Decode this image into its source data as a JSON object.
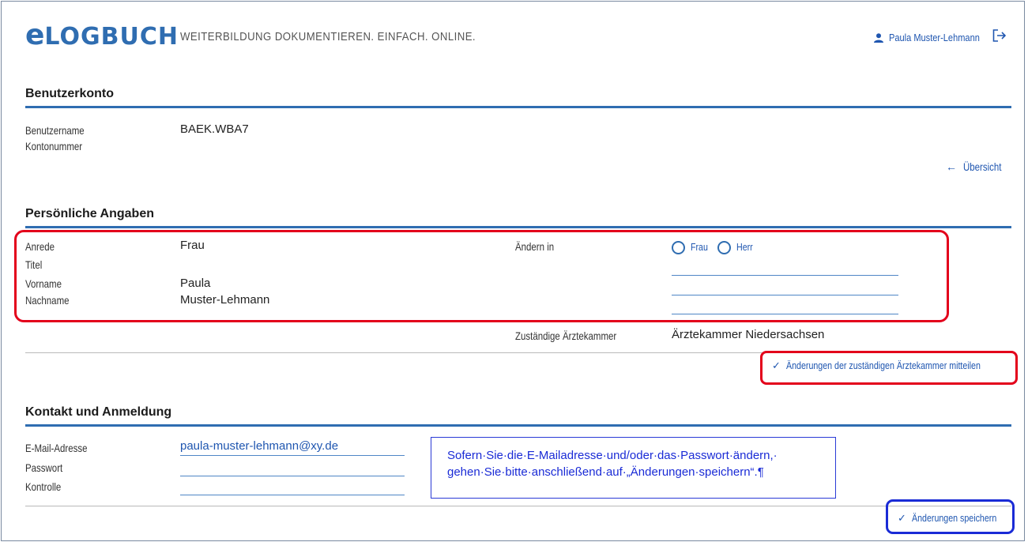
{
  "header": {
    "logo": "eLOGBUCH",
    "logo_e": "e",
    "logo_rest": "LOGBUCH",
    "tagline": "WEITERBILDUNG DOKUMENTIEREN. EINFACH. ONLINE.",
    "user_name": "Paula Muster-Lehmann"
  },
  "account": {
    "title": "Benutzerkonto",
    "username_label": "Benutzername",
    "username_value": "BAEK.WBA7",
    "account_number_label": "Kontonummer",
    "overview_link": "Übersicht"
  },
  "personal": {
    "title": "Persönliche Angaben",
    "salutation_label": "Anrede",
    "salutation_value": "Frau",
    "title_label": "Titel",
    "firstname_label": "Vorname",
    "firstname_value": "Paula",
    "lastname_label": "Nachname",
    "lastname_value": "Muster-Lehmann",
    "change_label": "Ändern in",
    "radio_frau": "Frau",
    "radio_herr": "Herr",
    "chamber_label": "Zuständige Ärztekammer",
    "chamber_value": "Ärztekammer Niedersachsen",
    "notify_button": "Änderungen der zuständigen Ärztekammer mitteilen"
  },
  "contact": {
    "title": "Kontakt und Anmeldung",
    "email_label": "E-Mail-Adresse",
    "email_value": "paula-muster-lehmann@xy.de",
    "password_label": "Passwort",
    "confirm_label": "Kontrolle",
    "note_line1": "Sofern·Sie·die·E-Mailadresse·und/oder·das·Passwort·ändern,·",
    "note_line2": "gehen·Sie·bitte·anschließend·auf·„Änderungen·speichern“.¶",
    "save_button": "Änderungen speichern"
  },
  "colors": {
    "brand_blue": "#2f6db1",
    "highlight_red": "#e3001b",
    "highlight_blue": "#1a2bd6"
  }
}
